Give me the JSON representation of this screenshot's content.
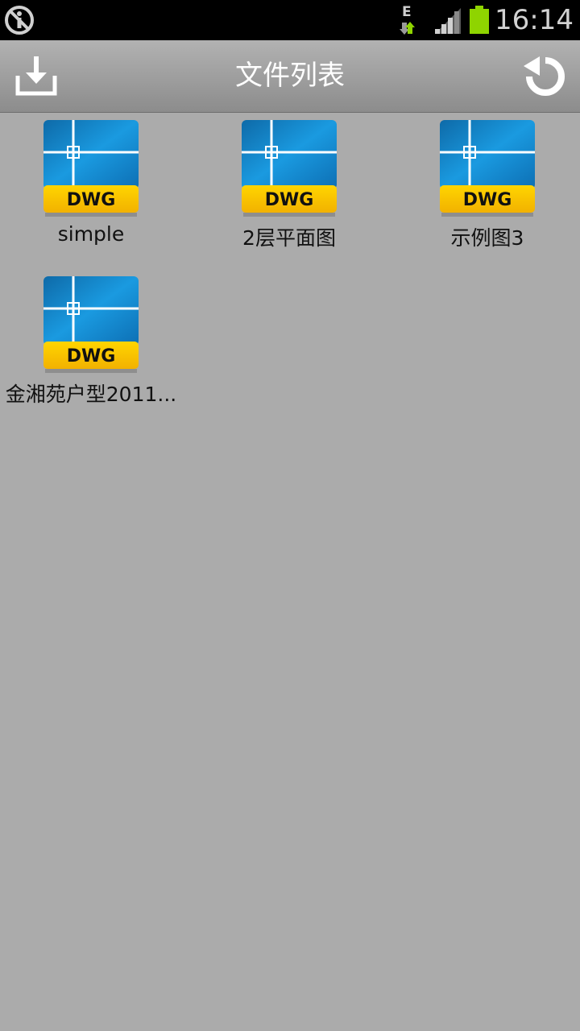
{
  "status_bar": {
    "network_type": "E",
    "time": "16:14",
    "icons": [
      "settings-info-icon",
      "data-transfer-icon",
      "signal-icon",
      "battery-icon"
    ],
    "battery_color": "#8fd400"
  },
  "toolbar": {
    "title": "文件列表",
    "left_icon": "download-icon",
    "right_icon": "refresh-icon"
  },
  "files": [
    {
      "name": "simple",
      "type_label": "DWG"
    },
    {
      "name": "2层平面图",
      "type_label": "DWG"
    },
    {
      "name": "示例图3",
      "type_label": "DWG"
    },
    {
      "name": "金湘苑户型2011...",
      "type_label": "DWG"
    }
  ],
  "colors": {
    "background": "#ababab",
    "icon_blue": "#1592d6",
    "icon_yellow": "#ffc800"
  }
}
